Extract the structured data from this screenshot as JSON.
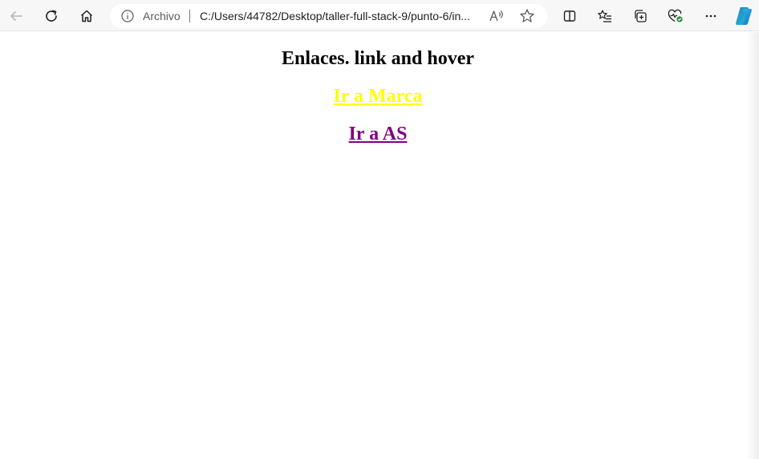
{
  "browser": {
    "address": {
      "scheme_label": "Archivo",
      "url": "C:/Users/44782/Desktop/taller-full-stack-9/punto-6/in..."
    },
    "icons": {
      "back": "back-arrow-icon",
      "refresh": "refresh-icon",
      "home": "home-icon",
      "info": "info-icon",
      "read_aloud": "read-aloud-icon",
      "favorite": "star-icon",
      "split": "split-screen-icon",
      "favorites": "favorites-list-icon",
      "collections": "collections-icon",
      "health": "browser-essentials-icon",
      "more": "more-icon",
      "copilot": "copilot-icon"
    }
  },
  "page": {
    "heading": "Enlaces. link and hover",
    "links": [
      {
        "label": "Ir a Marca",
        "color": "#ffff00"
      },
      {
        "label": "Ir a AS",
        "color": "#800080"
      }
    ]
  }
}
